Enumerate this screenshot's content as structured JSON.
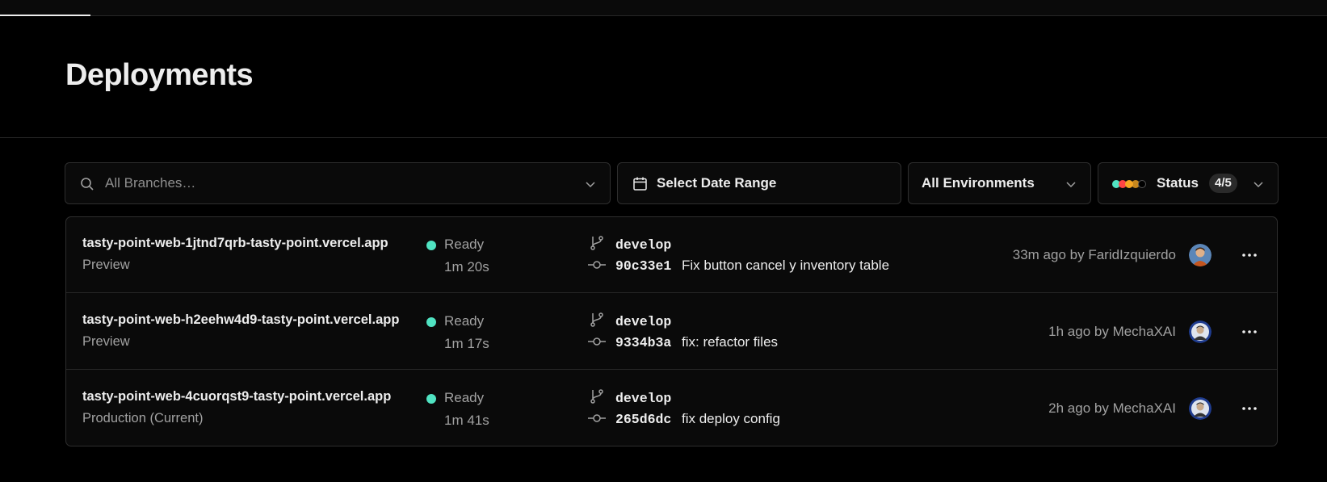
{
  "page": {
    "title": "Deployments"
  },
  "filters": {
    "branch_placeholder": "All Branches…",
    "date_label": "Select Date Range",
    "environment_label": "All Environments",
    "status_label": "Status",
    "status_count": "4/5",
    "status_dot_colors": [
      "#50e3c2",
      "#ff4444",
      "#f5a623",
      "#f5a623",
      "#333333"
    ]
  },
  "colors": {
    "ready": "#50e3c2",
    "accent_text": "#ededed",
    "muted_text": "#a1a1a1"
  },
  "deployments": [
    {
      "url": "tasty-point-web-1jtnd7qrb-tasty-point.vercel.app",
      "environment": "Preview",
      "status": "Ready",
      "duration": "1m 20s",
      "branch": "develop",
      "commit_hash": "90c33e1",
      "commit_message": "Fix button cancel y inventory table",
      "meta": "33m ago by FaridIzquierdo",
      "avatar_icon": "user-avatar-photo"
    },
    {
      "url": "tasty-point-web-h2eehw4d9-tasty-point.vercel.app",
      "environment": "Preview",
      "status": "Ready",
      "duration": "1m 17s",
      "branch": "develop",
      "commit_hash": "9334b3a",
      "commit_message": "fix: refactor files",
      "meta": "1h ago by MechaXAI",
      "avatar_icon": "user-avatar-photo"
    },
    {
      "url": "tasty-point-web-4cuorqst9-tasty-point.vercel.app",
      "environment": "Production (Current)",
      "status": "Ready",
      "duration": "1m 41s",
      "branch": "develop",
      "commit_hash": "265d6dc",
      "commit_message": "fix deploy config",
      "meta": "2h ago by MechaXAI",
      "avatar_icon": "user-avatar-photo"
    }
  ]
}
